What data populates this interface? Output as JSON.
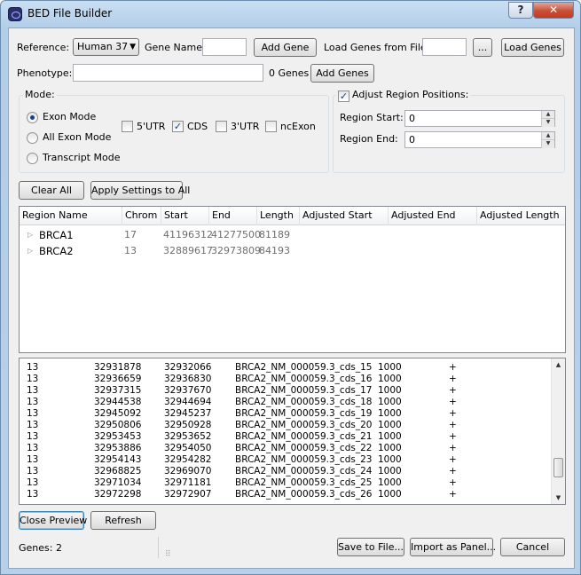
{
  "window": {
    "title": "BED File Builder",
    "help_label": "?",
    "close_label": "✕"
  },
  "top": {
    "reference_label": "Reference:",
    "reference_value": "Human 37",
    "gene_name_label": "Gene Name:",
    "gene_name_value": "",
    "add_gene_label": "Add Gene",
    "load_genes_from_file_label": "Load Genes from File:",
    "load_file_value": "",
    "browse_label": "...",
    "load_genes_label": "Load Genes",
    "phenotype_label": "Phenotype:",
    "phenotype_value": "",
    "genes_count": "0 Genes",
    "add_genes_label": "Add  Genes"
  },
  "mode": {
    "title": "Mode:",
    "options": [
      {
        "label": "Exon Mode",
        "selected": true
      },
      {
        "label": "All Exon Mode",
        "selected": false
      },
      {
        "label": "Transcript Mode",
        "selected": false
      }
    ],
    "checks": [
      {
        "label": "5'UTR",
        "checked": false
      },
      {
        "label": "CDS",
        "checked": true
      },
      {
        "label": "3'UTR",
        "checked": false
      },
      {
        "label": "ncExon",
        "checked": false
      }
    ]
  },
  "adjust": {
    "title": "Adjust Region Positions:",
    "checked": true,
    "region_start_label": "Region Start:",
    "region_start_value": "0",
    "region_end_label": "Region End:",
    "region_end_value": "0"
  },
  "actions": {
    "clear_all": "Clear All",
    "apply_settings": "Apply Settings to All"
  },
  "regions": {
    "columns": [
      "Region Name",
      "Chrom",
      "Start",
      "End",
      "Length",
      "Adjusted Start",
      "Adjusted End",
      "Adjusted Length"
    ],
    "rows": [
      {
        "name": "BRCA1",
        "chrom": "17",
        "start": "41196312",
        "end": "41277500",
        "length": "81189"
      },
      {
        "name": "BRCA2",
        "chrom": "13",
        "start": "32889617",
        "end": "32973809",
        "length": "84193"
      }
    ]
  },
  "preview": {
    "rows": [
      [
        "13",
        "32931878",
        "32932066",
        "BRCA2_NM_000059.3_cds_15",
        "1000",
        "+"
      ],
      [
        "13",
        "32936659",
        "32936830",
        "BRCA2_NM_000059.3_cds_16",
        "1000",
        "+"
      ],
      [
        "13",
        "32937315",
        "32937670",
        "BRCA2_NM_000059.3_cds_17",
        "1000",
        "+"
      ],
      [
        "13",
        "32944538",
        "32944694",
        "BRCA2_NM_000059.3_cds_18",
        "1000",
        "+"
      ],
      [
        "13",
        "32945092",
        "32945237",
        "BRCA2_NM_000059.3_cds_19",
        "1000",
        "+"
      ],
      [
        "13",
        "32950806",
        "32950928",
        "BRCA2_NM_000059.3_cds_20",
        "1000",
        "+"
      ],
      [
        "13",
        "32953453",
        "32953652",
        "BRCA2_NM_000059.3_cds_21",
        "1000",
        "+"
      ],
      [
        "13",
        "32953886",
        "32954050",
        "BRCA2_NM_000059.3_cds_22",
        "1000",
        "+"
      ],
      [
        "13",
        "32954143",
        "32954282",
        "BRCA2_NM_000059.3_cds_23",
        "1000",
        "+"
      ],
      [
        "13",
        "32968825",
        "32969070",
        "BRCA2_NM_000059.3_cds_24",
        "1000",
        "+"
      ],
      [
        "13",
        "32971034",
        "32971181",
        "BRCA2_NM_000059.3_cds_25",
        "1000",
        "+"
      ],
      [
        "13",
        "32972298",
        "32972907",
        "BRCA2_NM_000059.3_cds_26",
        "1000",
        "+"
      ]
    ]
  },
  "bottom": {
    "close_preview": "Close Preview",
    "refresh": "Refresh",
    "genes_status": "Genes: 2",
    "save_to_file": "Save to File...",
    "import_as_panel": "Import as Panel...",
    "cancel": "Cancel"
  },
  "colors": {
    "title_gradient_top": "#c9dff2",
    "close_red": "#c6391f",
    "selected_radio": "#1a3f8f",
    "focus_blue": "#3c7fb1"
  }
}
